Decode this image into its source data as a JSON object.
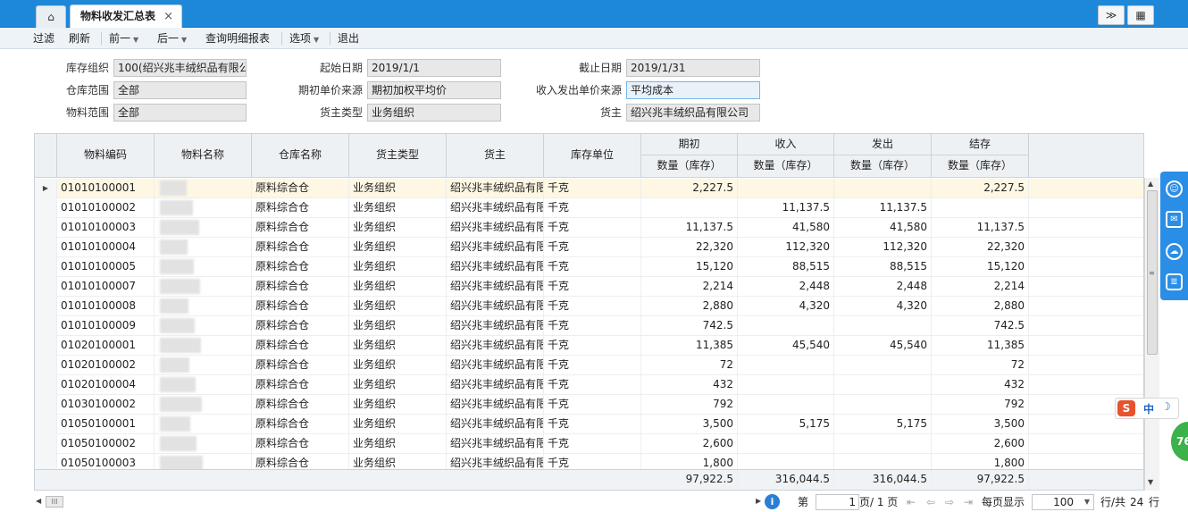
{
  "tabs": {
    "home_icon": "home-icon",
    "active_label": "物料收发汇总表",
    "close_glyph": "×",
    "collapse_glyph": "≫",
    "grid_glyph": "▦"
  },
  "toolbar": {
    "filter": "过滤",
    "refresh": "刷新",
    "prev": "前一",
    "next": "后一",
    "detail": "查询明细报表",
    "options": "选项",
    "exit": "退出"
  },
  "form": {
    "stock_org_label": "库存组织",
    "stock_org_value": "100(绍兴兆丰绒织品有限公",
    "warehouse_label": "仓库范围",
    "warehouse_value": "全部",
    "material_label": "物料范围",
    "material_value": "全部",
    "start_label": "起始日期",
    "start_value": "2019/1/1",
    "init_price_label": "期初单价来源",
    "init_price_value": "期初加权平均价",
    "owner_type_label": "货主类型",
    "owner_type_value": "业务组织",
    "end_label": "截止日期",
    "end_value": "2019/1/31",
    "io_price_label": "收入发出单价来源",
    "io_price_value": "平均成本",
    "owner_label": "货主",
    "owner_value": "绍兴兆丰绒织品有限公司"
  },
  "grid": {
    "headers": {
      "code": "物料编码",
      "name": "物料名称",
      "warehouse": "仓库名称",
      "owner_type": "货主类型",
      "owner": "货主",
      "unit": "库存单位",
      "opening": "期初",
      "income": "收入",
      "outgo": "发出",
      "closing": "结存",
      "qty": "数量（库存）"
    },
    "rows": [
      {
        "code": "01010100001",
        "warehouse": "原料综合仓",
        "owner_type": "业务组织",
        "owner": "绍兴兆丰绒织品有限",
        "unit": "千克",
        "opening": "2,227.5",
        "income": "",
        "outgo": "",
        "closing": "2,227.5"
      },
      {
        "code": "01010100002",
        "warehouse": "原料综合仓",
        "owner_type": "业务组织",
        "owner": "绍兴兆丰绒织品有限",
        "unit": "千克",
        "opening": "",
        "income": "11,137.5",
        "outgo": "11,137.5",
        "closing": ""
      },
      {
        "code": "01010100003",
        "warehouse": "原料综合仓",
        "owner_type": "业务组织",
        "owner": "绍兴兆丰绒织品有限",
        "unit": "千克",
        "opening": "11,137.5",
        "income": "41,580",
        "outgo": "41,580",
        "closing": "11,137.5"
      },
      {
        "code": "01010100004",
        "warehouse": "原料综合仓",
        "owner_type": "业务组织",
        "owner": "绍兴兆丰绒织品有限",
        "unit": "千克",
        "opening": "22,320",
        "income": "112,320",
        "outgo": "112,320",
        "closing": "22,320"
      },
      {
        "code": "01010100005",
        "warehouse": "原料综合仓",
        "owner_type": "业务组织",
        "owner": "绍兴兆丰绒织品有限",
        "unit": "千克",
        "opening": "15,120",
        "income": "88,515",
        "outgo": "88,515",
        "closing": "15,120"
      },
      {
        "code": "01010100007",
        "warehouse": "原料综合仓",
        "owner_type": "业务组织",
        "owner": "绍兴兆丰绒织品有限",
        "unit": "千克",
        "opening": "2,214",
        "income": "2,448",
        "outgo": "2,448",
        "closing": "2,214"
      },
      {
        "code": "01010100008",
        "warehouse": "原料综合仓",
        "owner_type": "业务组织",
        "owner": "绍兴兆丰绒织品有限",
        "unit": "千克",
        "opening": "2,880",
        "income": "4,320",
        "outgo": "4,320",
        "closing": "2,880"
      },
      {
        "code": "01010100009",
        "warehouse": "原料综合仓",
        "owner_type": "业务组织",
        "owner": "绍兴兆丰绒织品有限",
        "unit": "千克",
        "opening": "742.5",
        "income": "",
        "outgo": "",
        "closing": "742.5"
      },
      {
        "code": "01020100001",
        "warehouse": "原料综合仓",
        "owner_type": "业务组织",
        "owner": "绍兴兆丰绒织品有限",
        "unit": "千克",
        "opening": "11,385",
        "income": "45,540",
        "outgo": "45,540",
        "closing": "11,385"
      },
      {
        "code": "01020100002",
        "warehouse": "原料综合仓",
        "owner_type": "业务组织",
        "owner": "绍兴兆丰绒织品有限",
        "unit": "千克",
        "opening": "72",
        "income": "",
        "outgo": "",
        "closing": "72"
      },
      {
        "code": "01020100004",
        "warehouse": "原料综合仓",
        "owner_type": "业务组织",
        "owner": "绍兴兆丰绒织品有限",
        "unit": "千克",
        "opening": "432",
        "income": "",
        "outgo": "",
        "closing": "432"
      },
      {
        "code": "01030100002",
        "warehouse": "原料综合仓",
        "owner_type": "业务组织",
        "owner": "绍兴兆丰绒织品有限",
        "unit": "千克",
        "opening": "792",
        "income": "",
        "outgo": "",
        "closing": "792"
      },
      {
        "code": "01050100001",
        "warehouse": "原料综合仓",
        "owner_type": "业务组织",
        "owner": "绍兴兆丰绒织品有限",
        "unit": "千克",
        "opening": "3,500",
        "income": "5,175",
        "outgo": "5,175",
        "closing": "3,500"
      },
      {
        "code": "01050100002",
        "warehouse": "原料综合仓",
        "owner_type": "业务组织",
        "owner": "绍兴兆丰绒织品有限",
        "unit": "千克",
        "opening": "2,600",
        "income": "",
        "outgo": "",
        "closing": "2,600"
      },
      {
        "code": "01050100003",
        "warehouse": "原料综合仓",
        "owner_type": "业务组织",
        "owner": "绍兴兆丰绒织品有限",
        "unit": "千克",
        "opening": "1,800",
        "income": "",
        "outgo": "",
        "closing": "1,800"
      }
    ],
    "totals": {
      "opening": "97,922.5",
      "income": "316,044.5",
      "outgo": "316,044.5",
      "closing": "97,922.5"
    }
  },
  "pager": {
    "page_prefix": "第",
    "page_value": "1",
    "page_suffix": "页/ 1 页",
    "per_page_label": "每页显示",
    "per_page_value": "100",
    "total_label": "行/共",
    "total_value": "24",
    "total_suffix": "行",
    "hscroll_glyph": "III",
    "info_glyph": "i"
  },
  "side": {
    "icons": [
      "robot-icon",
      "chat-icon",
      "cloud-icon",
      "database-icon"
    ]
  },
  "ime": {
    "logo": "S",
    "mode": "中",
    "moon": "☽"
  },
  "badge": {
    "value": "76"
  },
  "colors": {
    "tabbar": "#1e88d8",
    "selected_row": "#fdf7e3",
    "side_panel": "#2b8ee6",
    "badge": "#3cb24a"
  }
}
